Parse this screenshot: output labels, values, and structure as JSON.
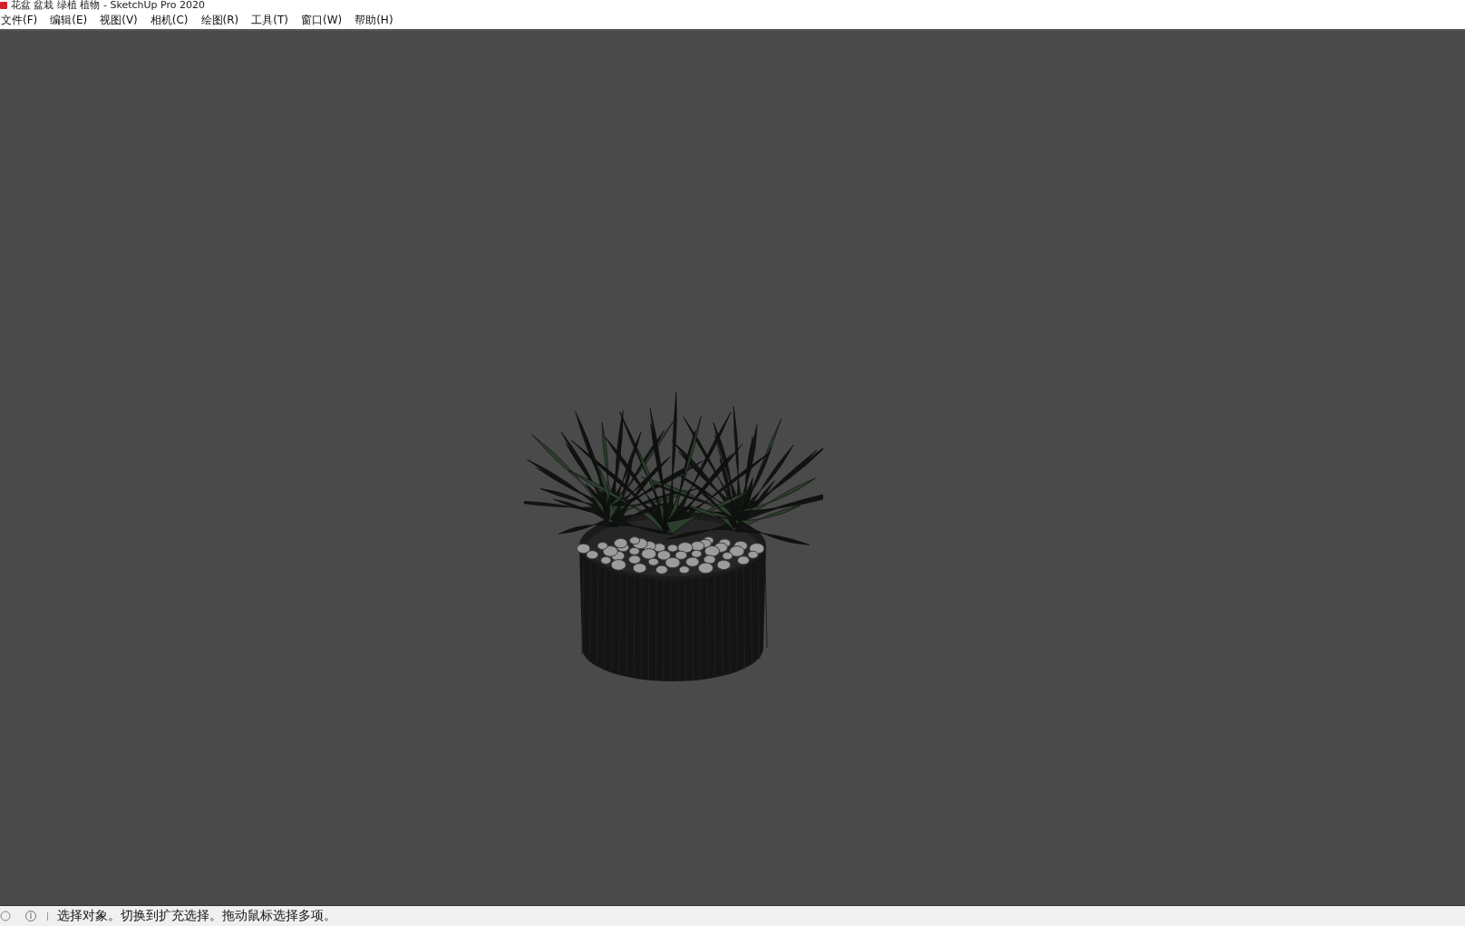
{
  "window": {
    "title": "花盆 盆栽 绿植 植物 - SketchUp Pro 2020"
  },
  "menu_bar": {
    "items": [
      "文件(F)",
      "编辑(E)",
      "视图(V)",
      "相机(C)",
      "绘图(R)",
      "工具(T)",
      "窗口(W)",
      "帮助(H)"
    ]
  },
  "status_bar": {
    "message": "选择对象。切换到扩充选择。拖动鼠标选择多项。"
  }
}
